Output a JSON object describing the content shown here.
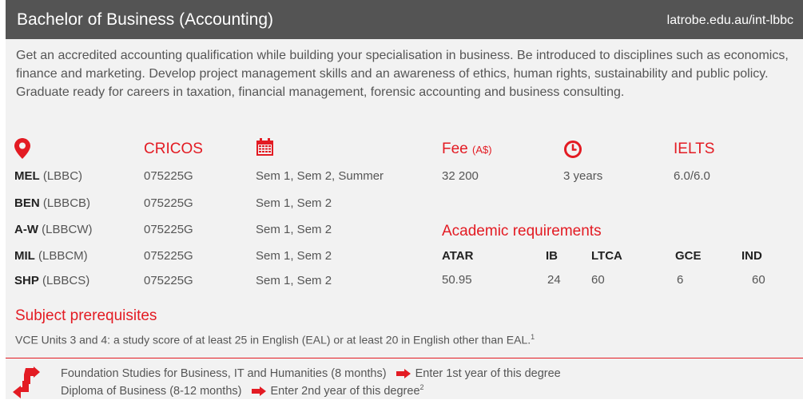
{
  "header": {
    "title": "Bachelor of Business (Accounting)",
    "url": "latrobe.edu.au/int-lbbc"
  },
  "description": "Get an accredited accounting qualification while building your specialisation in business. Be introduced to disciplines such as economics, finance and marketing. Develop project management skills and an awareness of ethics, human rights, sustainability and public policy. Graduate ready for careers in taxation, financial management, forensic accounting and business consulting.",
  "icons": {
    "location": "location-pin-icon",
    "calendar": "calendar-icon",
    "duration": "clock-icon",
    "pathway": "pathway-arrows-icon"
  },
  "colors": {
    "accent": "#e31b23",
    "header_bg": "#545454",
    "card_bg": "#f2f2f2"
  },
  "labels": {
    "cricos": "CRICOS",
    "fee": "Fee",
    "fee_unit": "(A$)",
    "ielts": "IELTS",
    "academic": "Academic requirements",
    "prereq": "Subject prerequisites"
  },
  "campuses": [
    {
      "code": "MEL",
      "course": "(LBBC)",
      "cricos": "075225G",
      "intake": "Sem 1, Sem 2, Summer"
    },
    {
      "code": "BEN",
      "course": "(LBBCB)",
      "cricos": "075225G",
      "intake": "Sem 1, Sem 2"
    },
    {
      "code": "A-W",
      "course": "(LBBCW)",
      "cricos": "075225G",
      "intake": "Sem 1, Sem 2"
    },
    {
      "code": "MIL",
      "course": "(LBBCM)",
      "cricos": "075225G",
      "intake": "Sem 1, Sem 2"
    },
    {
      "code": "SHP",
      "course": "(LBBCS)",
      "cricos": "075225G",
      "intake": "Sem 1, Sem 2"
    }
  ],
  "fee_value": "32 200",
  "duration": "3 years",
  "ielts_value": "6.0/6.0",
  "academic": {
    "headers": [
      "ATAR",
      "IB",
      "LTCA",
      "GCE",
      "IND"
    ],
    "values": [
      "50.95",
      "24",
      "60",
      "6",
      "60"
    ]
  },
  "prereq_text": "VCE Units 3 and 4: a study score of at least 25 in English (EAL) or at least 20 in English other than EAL.",
  "prereq_note": "1",
  "pathways": [
    {
      "from": "Foundation Studies for Business, IT and Humanities (8 months)",
      "to": "Enter 1st year of this degree",
      "note": ""
    },
    {
      "from": "Diploma of Business (8-12 months)",
      "to": "Enter 2nd year of this degree",
      "note": "2"
    }
  ]
}
